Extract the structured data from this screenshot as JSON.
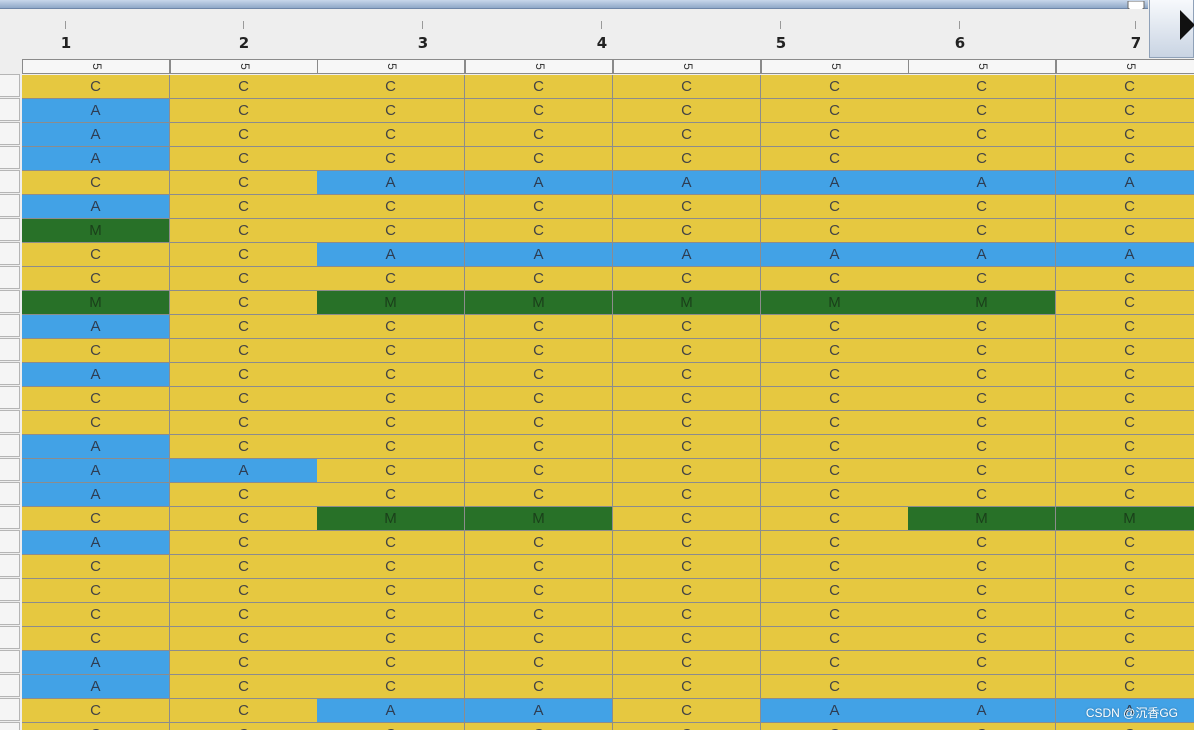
{
  "header": {
    "column_numbers": [
      "1",
      "2",
      "3",
      "4",
      "5",
      "6",
      "7"
    ],
    "subheader_values": [
      "5",
      "5",
      "5",
      "5",
      "5",
      "5",
      "5",
      "5"
    ]
  },
  "legend_colors": {
    "C": "#e6c840",
    "A": "#42a2e6",
    "M": "#287128"
  },
  "grid": {
    "rows": [
      [
        "C",
        "C",
        "C",
        "C",
        "C",
        "C",
        "C",
        "C"
      ],
      [
        "A",
        "C",
        "C",
        "C",
        "C",
        "C",
        "C",
        "C"
      ],
      [
        "A",
        "C",
        "C",
        "C",
        "C",
        "C",
        "C",
        "C"
      ],
      [
        "A",
        "C",
        "C",
        "C",
        "C",
        "C",
        "C",
        "C"
      ],
      [
        "C",
        "C",
        "A",
        "A",
        "A",
        "A",
        "A",
        "A"
      ],
      [
        "A",
        "C",
        "C",
        "C",
        "C",
        "C",
        "C",
        "C"
      ],
      [
        "M",
        "C",
        "C",
        "C",
        "C",
        "C",
        "C",
        "C"
      ],
      [
        "C",
        "C",
        "A",
        "A",
        "A",
        "A",
        "A",
        "A"
      ],
      [
        "C",
        "C",
        "C",
        "C",
        "C",
        "C",
        "C",
        "C"
      ],
      [
        "M",
        "C",
        "M",
        "M",
        "M",
        "M",
        "M",
        "C"
      ],
      [
        "A",
        "C",
        "C",
        "C",
        "C",
        "C",
        "C",
        "C"
      ],
      [
        "C",
        "C",
        "C",
        "C",
        "C",
        "C",
        "C",
        "C"
      ],
      [
        "A",
        "C",
        "C",
        "C",
        "C",
        "C",
        "C",
        "C"
      ],
      [
        "C",
        "C",
        "C",
        "C",
        "C",
        "C",
        "C",
        "C"
      ],
      [
        "C",
        "C",
        "C",
        "C",
        "C",
        "C",
        "C",
        "C"
      ],
      [
        "A",
        "C",
        "C",
        "C",
        "C",
        "C",
        "C",
        "C"
      ],
      [
        "A",
        "A",
        "C",
        "C",
        "C",
        "C",
        "C",
        "C"
      ],
      [
        "A",
        "C",
        "C",
        "C",
        "C",
        "C",
        "C",
        "C"
      ],
      [
        "C",
        "C",
        "M",
        "M",
        "C",
        "C",
        "M",
        "M"
      ],
      [
        "A",
        "C",
        "C",
        "C",
        "C",
        "C",
        "C",
        "C"
      ],
      [
        "C",
        "C",
        "C",
        "C",
        "C",
        "C",
        "C",
        "C"
      ],
      [
        "C",
        "C",
        "C",
        "C",
        "C",
        "C",
        "C",
        "C"
      ],
      [
        "C",
        "C",
        "C",
        "C",
        "C",
        "C",
        "C",
        "C"
      ],
      [
        "C",
        "C",
        "C",
        "C",
        "C",
        "C",
        "C",
        "C"
      ],
      [
        "A",
        "C",
        "C",
        "C",
        "C",
        "C",
        "C",
        "C"
      ],
      [
        "A",
        "C",
        "C",
        "C",
        "C",
        "C",
        "C",
        "C"
      ],
      [
        "C",
        "C",
        "A",
        "A",
        "C",
        "A",
        "A",
        "A"
      ],
      [
        "C",
        "C",
        "C",
        "C",
        "C",
        "C",
        "C",
        "C"
      ]
    ]
  },
  "watermark": "CSDN @沉香GG"
}
